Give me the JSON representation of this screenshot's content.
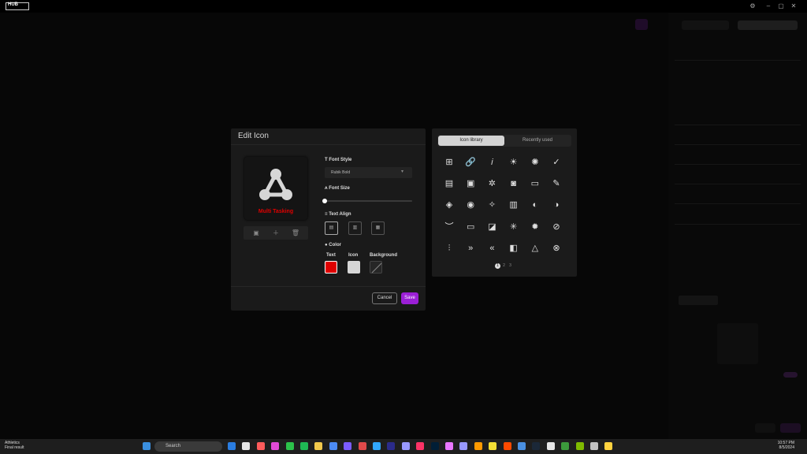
{
  "app": {
    "logo_text": "HUB"
  },
  "window_controls": {
    "settings": "⚙",
    "minimize": "–",
    "maximize": "▢",
    "close": "✕"
  },
  "dialog": {
    "title": "Edit Icon",
    "preview_label": "Multi Tasking",
    "toolbar": {
      "image": "▣",
      "add": "＋",
      "delete": "🗑"
    },
    "font_style": {
      "label": "Font Style",
      "value": "Rubik Bold",
      "icon": "T"
    },
    "font_size": {
      "label": "Font Size",
      "value_fraction": 0
    },
    "text_align": {
      "label": "Text Align",
      "options": [
        "top",
        "middle",
        "bottom"
      ],
      "selected": "top"
    },
    "color": {
      "label": "Color",
      "text_label": "Text",
      "text_color": "#e00000",
      "icon_label": "Icon",
      "icon_color": "#d6d6d6",
      "background_label": "Background",
      "background_color": "none"
    },
    "cancel": "Cancel",
    "save": "Save",
    "accent": "#9b1fd6"
  },
  "icon_library": {
    "tabs": [
      "Icon library",
      "Recently used"
    ],
    "active_tab": "Icon library",
    "icons": [
      [
        "grid-icon",
        "link-icon",
        "italic-icon",
        "sun-people-icon",
        "brightness-icon",
        "check-icon"
      ],
      [
        "chat-icon",
        "chat-alert-icon",
        "bug-icon",
        "camera-icon",
        "window-icon",
        "note-icon"
      ],
      [
        "shield-icon",
        "chat-bubble-icon",
        "sparkle-icon",
        "people-icon",
        "user-add-icon",
        "user-settings-icon"
      ],
      [
        "eye-closed-icon",
        "monitor-icon",
        "user-chat-icon",
        "light-icon",
        "bulb-icon",
        "sun-off-icon"
      ],
      [
        "sliders-icon",
        "chevrons-right-icon",
        "chevrons-left-icon",
        "flash-icon",
        "network-icon",
        "mic-off-icon"
      ]
    ],
    "glyphs": [
      [
        "⊞",
        "🔗",
        "𝑖",
        "☀",
        "✺",
        "✓"
      ],
      [
        "▤",
        "▣",
        "✲",
        "◙",
        "▭",
        "✎"
      ],
      [
        "◈",
        "◉",
        "✧",
        "▥",
        "◐",
        "◑"
      ],
      [
        "︶",
        "▭",
        "◪",
        "✳",
        "✹",
        "⊘"
      ],
      [
        "⫶",
        "»",
        "«",
        "◧",
        "△",
        "⊗"
      ]
    ],
    "pages": [
      "1",
      "2",
      "3"
    ],
    "current_page": "1"
  },
  "taskbar": {
    "weather_team": "Athletics",
    "weather_note": "Final result",
    "search": "Search",
    "time": "10:57 PM",
    "date": "8/5/2024"
  }
}
